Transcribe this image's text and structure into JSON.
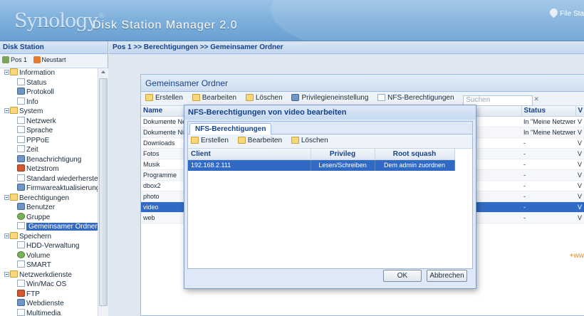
{
  "header": {
    "logo_text": "Synology",
    "logo_mark": "®",
    "app_title": "Disk Station Manager 2.0",
    "top_link": "File Sta"
  },
  "sidebar": {
    "title": "Disk Station",
    "tool_pos": "Pos 1",
    "tool_restart": "Neustart",
    "tree": [
      {
        "label": "Information",
        "level": 1,
        "icon": "folder-icon"
      },
      {
        "label": "Status",
        "level": 2,
        "icon": "page-icon"
      },
      {
        "label": "Protokoll",
        "level": 2,
        "icon": "log-icon"
      },
      {
        "label": "Info",
        "level": 2,
        "icon": "page-icon"
      },
      {
        "label": "System",
        "level": 1,
        "icon": "folder-icon"
      },
      {
        "label": "Netzwerk",
        "level": 2,
        "icon": "page-icon"
      },
      {
        "label": "Sprache",
        "level": 2,
        "icon": "page-icon"
      },
      {
        "label": "PPPoE",
        "level": 2,
        "icon": "page-icon"
      },
      {
        "label": "Zeit",
        "level": 2,
        "icon": "page-icon"
      },
      {
        "label": "Benachrichtigung",
        "level": 2,
        "icon": "notification-icon"
      },
      {
        "label": "Netzstrom",
        "level": 2,
        "icon": "power-icon"
      },
      {
        "label": "Standard wiederherstell",
        "level": 2,
        "icon": "page-icon"
      },
      {
        "label": "Firmwareaktualisierung",
        "level": 2,
        "icon": "update-icon"
      },
      {
        "label": "Berechtigungen",
        "level": 1,
        "icon": "folder-icon"
      },
      {
        "label": "Benutzer",
        "level": 2,
        "icon": "user-icon"
      },
      {
        "label": "Gruppe",
        "level": 2,
        "icon": "group-icon"
      },
      {
        "label": "Gemeinsamer Ordner",
        "level": 2,
        "icon": "page-icon",
        "selected": true
      },
      {
        "label": "Speichern",
        "level": 1,
        "icon": "folder-icon"
      },
      {
        "label": "HDD-Verwaltung",
        "level": 2,
        "icon": "hdd-icon"
      },
      {
        "label": "Volume",
        "level": 2,
        "icon": "volume-icon"
      },
      {
        "label": "SMART",
        "level": 2,
        "icon": "hdd-icon"
      },
      {
        "label": "Netzwerkdienste",
        "level": 1,
        "icon": "folder-icon"
      },
      {
        "label": "Win/Mac OS",
        "level": 2,
        "icon": "page-icon"
      },
      {
        "label": "FTP",
        "level": 2,
        "icon": "ftp-icon"
      },
      {
        "label": "Webdienste",
        "level": 2,
        "icon": "web-icon"
      },
      {
        "label": "Multimedia",
        "level": 2,
        "icon": "page-icon"
      }
    ]
  },
  "main": {
    "breadcrumb": "Pos 1 >> Berechtigungen >> Gemeinsamer Ordner",
    "panel_title": "Gemeinsamer Ordner",
    "toolbar": {
      "create": "Erstellen",
      "edit": "Bearbeiten",
      "delete": "Löschen",
      "privileges": "Privilegieneinstellung",
      "nfs": "NFS-Berechtigungen",
      "search_placeholder": "Suchen"
    },
    "columns": {
      "name": "Name",
      "status": "Status",
      "extra": "V"
    },
    "rows": [
      {
        "name": "Dokumente Ne",
        "status": "In \"Meine Netzwerk",
        "extra": "V"
      },
      {
        "name": "Dokumente Ni",
        "status": "In \"Meine Netzwerk",
        "extra": "V"
      },
      {
        "name": "Downloads",
        "status": "-",
        "extra": "V"
      },
      {
        "name": "Fotos",
        "status": "-",
        "extra": "V"
      },
      {
        "name": "Musik",
        "status": "-",
        "extra": "V"
      },
      {
        "name": "Programme",
        "status": "-",
        "extra": "V"
      },
      {
        "name": "dbox2",
        "status": "-",
        "extra": "V"
      },
      {
        "name": "photo",
        "status": "-",
        "extra": "V"
      },
      {
        "name": "video",
        "status": "-",
        "extra": "V",
        "selected": true
      },
      {
        "name": "web",
        "status": "-",
        "extra": "V"
      }
    ],
    "plus_link": "+ww"
  },
  "dialog": {
    "title": "NFS-Berechtigungen von video bearbeiten",
    "tab": "NFS-Berechtigungen",
    "toolbar": {
      "create": "Erstellen",
      "edit": "Bearbeiten",
      "delete": "Löschen"
    },
    "columns": {
      "client": "Client",
      "privilege": "Privileg",
      "root_squash": "Root squash"
    },
    "rows": [
      {
        "client": "192.168.2.111",
        "privilege": "Lesen/Schreiben",
        "root_squash": "Dem admin zuordnen"
      }
    ],
    "ok_label": "OK",
    "cancel_label": "Abbrechen"
  }
}
